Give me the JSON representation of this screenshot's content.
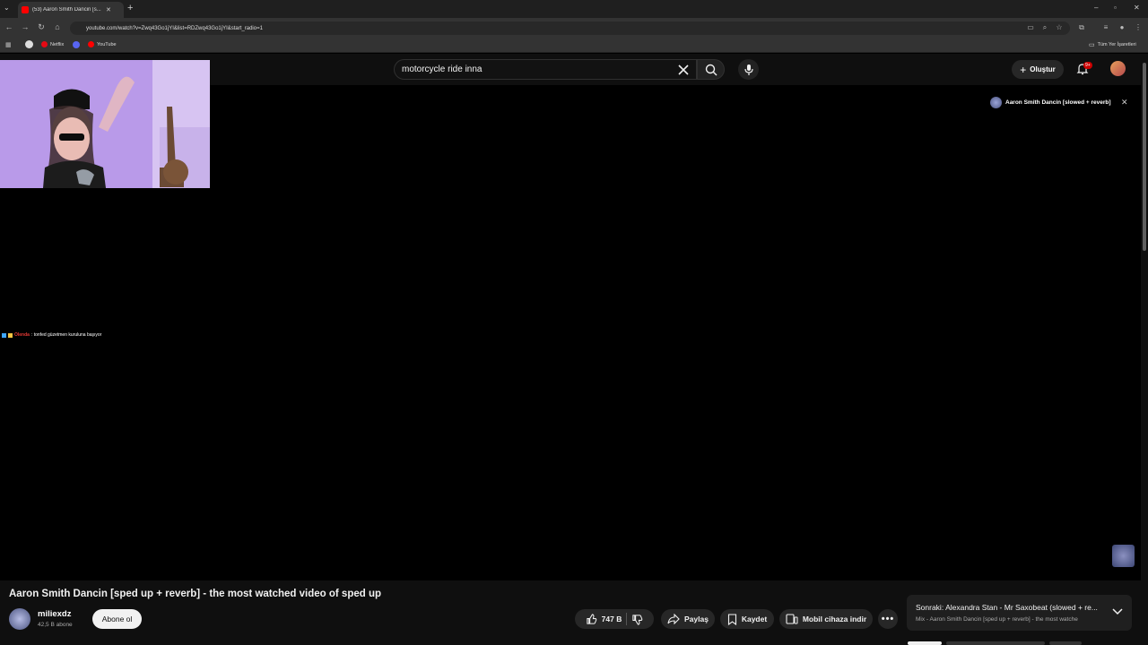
{
  "browser": {
    "tab_title": "(53) Aaron Smith Dancin [s...",
    "url": "youtube.com/watch?v=Zwq43Go1jYI&list=RDZwq43Go1jYI&start_radio=1",
    "bookmarks": [
      {
        "label": "Netflix",
        "color": "#e50914"
      },
      {
        "label": "YouTube",
        "color": "#ff0000"
      }
    ],
    "all_bookmarks_label": "Tüm Yer İşaretleri"
  },
  "header": {
    "search_query": "motorcycle ride inna",
    "create_label": "Oluştur",
    "notification_badge": "9+"
  },
  "video": {
    "chat_user": "Olenda",
    "chat_message": ": tonfed güzetmen kuruluna başıyor",
    "overlay_title": "Aaron Smith Dancin [slowed + reverb]"
  },
  "info": {
    "title": "Aaron Smith Dancin [sped up + reverb] - the most watched video of sped up",
    "channel_name": "miliexdz",
    "subscriber_count": "42,5 B abone",
    "subscribe_label": "Abone ol",
    "like_count": "747 B",
    "share_label": "Paylaş",
    "save_label": "Kaydet",
    "download_label": "Mobil cihaza indir"
  },
  "next_up": {
    "title": "Sonraki: Alexandra Stan - Mr Saxobeat (slowed + re...",
    "subtitle": "Mix - Aaron Smith Dancin [sped up + reverb] - the most watche"
  },
  "colors": {
    "background": "#0f0f0f",
    "accent_red": "#ff0000",
    "pill": "#272727"
  }
}
